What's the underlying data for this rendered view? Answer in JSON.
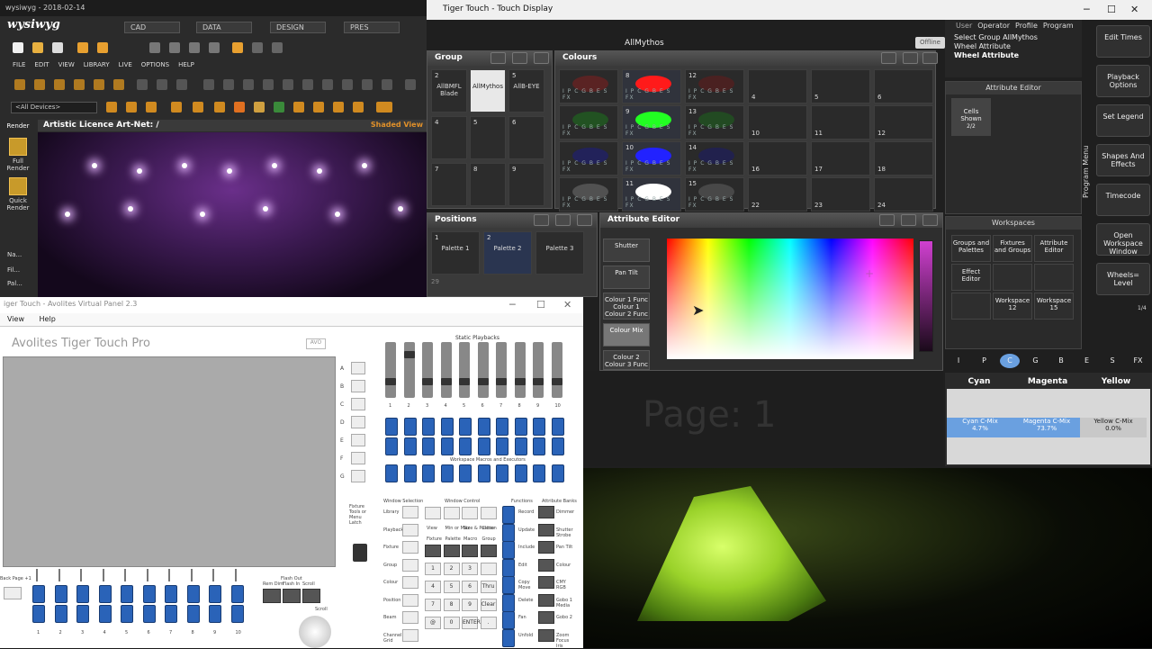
{
  "wysiwyg": {
    "window_title": "wysiwyg - 2018-02-14",
    "logo": "wysiwyg",
    "modes": [
      "CAD",
      "DATA",
      "DESIGN",
      "PRES"
    ],
    "menu": [
      "FILE",
      "EDIT",
      "VIEW",
      "LIBRARY",
      "LIVE",
      "OPTIONS",
      "HELP"
    ],
    "device_filter": "<All Devices>",
    "render_tab": "Render",
    "full_render": "Full Render",
    "quick_render": "Quick Render",
    "side_items": [
      "Na...",
      "Fil...",
      "Pal..."
    ],
    "view_title": "Artistic Licence Art-Net: /",
    "view_mode": "Shaded View"
  },
  "touch_display": {
    "window_title": "Tiger Touch - Touch Display",
    "show_name": "AllMythos",
    "status": "Offline",
    "group": {
      "title": "Group",
      "cells": [
        {
          "num": "2",
          "label": "AllBMFL Blade",
          "selected": false
        },
        {
          "num": "",
          "label": "AllMythos",
          "selected": true
        },
        {
          "num": "5",
          "label": "AllB-EYE",
          "selected": false
        },
        {
          "num": "4",
          "label": "",
          "selected": false
        },
        {
          "num": "5",
          "label": "",
          "selected": false
        },
        {
          "num": "6",
          "label": "",
          "selected": false
        },
        {
          "num": "7",
          "label": "",
          "selected": false
        },
        {
          "num": "8",
          "label": "",
          "selected": false
        },
        {
          "num": "9",
          "label": "",
          "selected": false
        }
      ]
    },
    "colours": {
      "title": "Colours",
      "cells": [
        {
          "num": "",
          "color": "#8a1c1c",
          "active": false
        },
        {
          "num": "8",
          "color": "#ff1a1a",
          "active": true
        },
        {
          "num": "12",
          "color": "#6a1818",
          "active": false
        },
        {
          "num": "",
          "color": "#1a7a1a",
          "active": false
        },
        {
          "num": "9",
          "color": "#22ff22",
          "active": true
        },
        {
          "num": "13",
          "color": "#1a6a1a",
          "active": false
        },
        {
          "num": "",
          "color": "#1a1a8a",
          "active": false
        },
        {
          "num": "10",
          "color": "#2222ff",
          "active": true
        },
        {
          "num": "14",
          "color": "#181870",
          "active": false
        },
        {
          "num": "",
          "color": "#777777",
          "active": false
        },
        {
          "num": "11",
          "color": "#ffffff",
          "active": true
        },
        {
          "num": "15",
          "color": "#666666",
          "active": false
        }
      ],
      "flags": "I P C G B E S FX",
      "empty_cells": [
        "4",
        "5",
        "6",
        "10",
        "11",
        "12",
        "16",
        "17",
        "18",
        "22",
        "23",
        "24"
      ]
    },
    "positions": {
      "title": "Positions",
      "cells": [
        {
          "num": "1",
          "label": "Palette 1"
        },
        {
          "num": "2",
          "label": "Palette 2"
        },
        {
          "num": "",
          "label": "Palette 3"
        }
      ],
      "row2_num": "29"
    },
    "attribute_editor_window": {
      "title": "Attribute Editor",
      "side_buttons": [
        "Shutter",
        "Pan Tilt",
        "Colour 1 Func Colour 1 Colour 2 Func",
        "Colour Mix",
        "Colour 2 Colour 3 Func"
      ]
    },
    "page_label": "Page: 1",
    "top_right": {
      "user_tabs": [
        "User",
        "Operator",
        "Profile",
        "Program"
      ],
      "lines": [
        "Select Group AllMythos",
        "Wheel Attribute",
        "Wheel Attribute"
      ]
    },
    "attr_editor_panel": {
      "title": "Attribute Editor",
      "cells_shown": "Cells Shown",
      "cells_page": "2/2"
    },
    "workspaces": {
      "title": "Workspaces",
      "buttons": [
        "Groups and Palettes",
        "Fixtures and Groups",
        "Attribute Editor",
        "Effect Editor",
        "",
        "",
        "",
        "Workspace 12",
        "Workspace 15"
      ]
    },
    "program_menu": {
      "label": "Program Menu",
      "buttons": [
        "Edit Times",
        "Playback Options",
        "Set Legend",
        "Shapes And Effects",
        "Timecode",
        "Open Workspace Window",
        "Wheels= Level"
      ],
      "wheels_page": "1/4"
    },
    "attribute_tabs": [
      "I",
      "P",
      "C",
      "G",
      "B",
      "E",
      "S",
      "FX"
    ],
    "active_tab": "C",
    "color_mix": [
      {
        "name": "Cyan",
        "label": "Cyan C-Mix",
        "value": "4.7%"
      },
      {
        "name": "Magenta",
        "label": "Magenta C-Mix",
        "value": "73.7%"
      },
      {
        "name": "Yellow",
        "label": "Yellow C-Mix",
        "value": "0.0%"
      }
    ]
  },
  "virtual_panel": {
    "window_title": "iger Touch - Avolites Virtual Panel 2.3",
    "menu": [
      "View",
      "Help"
    ],
    "heading": "Avolites Tiger Touch Pro",
    "static_playbacks": "Static Playbacks",
    "fader_numbers": [
      "1",
      "2",
      "3",
      "4",
      "5",
      "6",
      "7",
      "8",
      "9",
      "10"
    ],
    "letters": [
      "A",
      "B",
      "C",
      "D",
      "E",
      "F",
      "G"
    ],
    "workspace_label": "Workspace Macros and Executors",
    "fixture_tools": "Fixture Tools or Menu Latch",
    "section_labels": [
      "Window Selection",
      "Window Control",
      "Functions",
      "Attribute Banks"
    ],
    "window_sel": [
      "Library",
      "Playback",
      "Fixture",
      "Group",
      "Colour",
      "Position",
      "Beam",
      "Channel Grid"
    ],
    "window_ctrl": [
      "View",
      "Min or Max",
      "Size & Position",
      "Close"
    ],
    "fpmg": [
      "Fixture",
      "Palette",
      "Macro",
      "Group"
    ],
    "keypad": [
      "1",
      "2",
      "3",
      "",
      "4",
      "5",
      "6",
      "Thru",
      "7",
      "8",
      "9",
      "Clear",
      "@",
      "0",
      "ENTER",
      "."
    ],
    "functions": [
      "Record",
      "Update",
      "Include",
      "Edit",
      "Copy Move",
      "Delete",
      "Fan",
      "Unfold"
    ],
    "attr_banks": [
      "Dimmer",
      "Shutter Strobe",
      "Pan Tilt",
      "Colour",
      "CMY RGB",
      "Gobo 1 Media",
      "Gobo 2",
      "Zoom Focus Iris"
    ],
    "back_page": "Back Page +1",
    "flash_out": "Flash Out",
    "rem_dim": "Rem Dim",
    "flash_in": "Flash In",
    "scroll": "Scroll"
  }
}
